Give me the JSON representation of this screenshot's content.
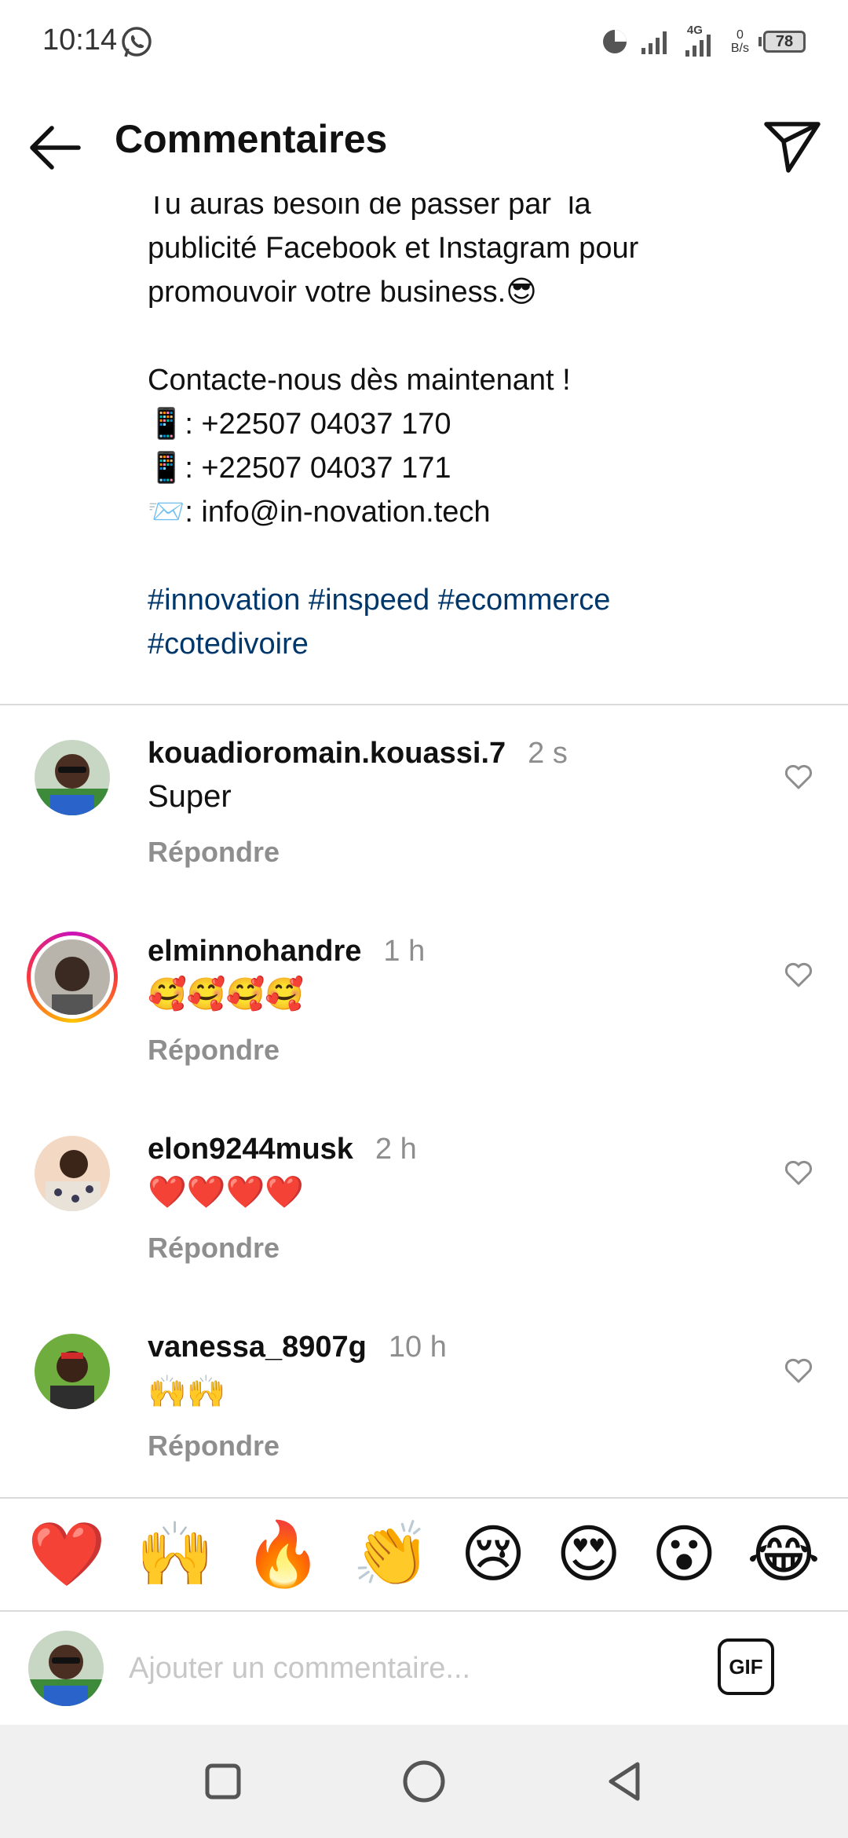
{
  "status_bar": {
    "time": "10:14",
    "network": "4G",
    "net_speed_value": "0",
    "net_speed_unit": "B/s",
    "battery": "78",
    "icons": [
      "whatsapp-icon",
      "data-saver-icon",
      "signal-icon",
      "battery-icon"
    ]
  },
  "header": {
    "title": "Commentaires",
    "back_icon": "arrow-left-icon",
    "share_icon": "paper-plane-icon"
  },
  "caption": {
    "lines": [
      "Tu auras besoin de passer par  la",
      "publicité Facebook et Instagram pour",
      "promouvoir votre business.😎",
      "",
      "Contacte-nous dès maintenant !",
      "📱: +22507 04037 170",
      "📱: +22507 04037 171",
      "📨: info@in-novation.tech",
      ""
    ],
    "hashtags_line1": "#innovation #inspeed #ecommerce",
    "hashtags_line2": "#cotedivoire"
  },
  "comments": [
    {
      "username": "kouadioromain.kouassi.7",
      "time": "2 s",
      "text": "Super",
      "reply_label": "Répondre",
      "has_story": false
    },
    {
      "username": "elminnohandre",
      "time": "1 h",
      "text": "🥰🥰🥰🥰",
      "reply_label": "Répondre",
      "has_story": true
    },
    {
      "username": "elon9244musk",
      "time": "2 h",
      "text": "❤️❤️❤️❤️",
      "reply_label": "Répondre",
      "has_story": false
    },
    {
      "username": "vanessa_8907g",
      "time": "10 h",
      "text": "🙌🙌",
      "reply_label": "Répondre",
      "has_story": false
    }
  ],
  "emoji_bar": [
    "❤️",
    "🙌",
    "🔥",
    "👏",
    "😢",
    "😍",
    "😮",
    "😂"
  ],
  "composer": {
    "placeholder": "Ajouter un commentaire...",
    "gif_label": "GIF"
  },
  "colors": {
    "hashtag": "#00376b",
    "secondary_text": "#8e8e8e",
    "divider": "#dbdbdb",
    "nav_bar": "#f0f0f0"
  }
}
